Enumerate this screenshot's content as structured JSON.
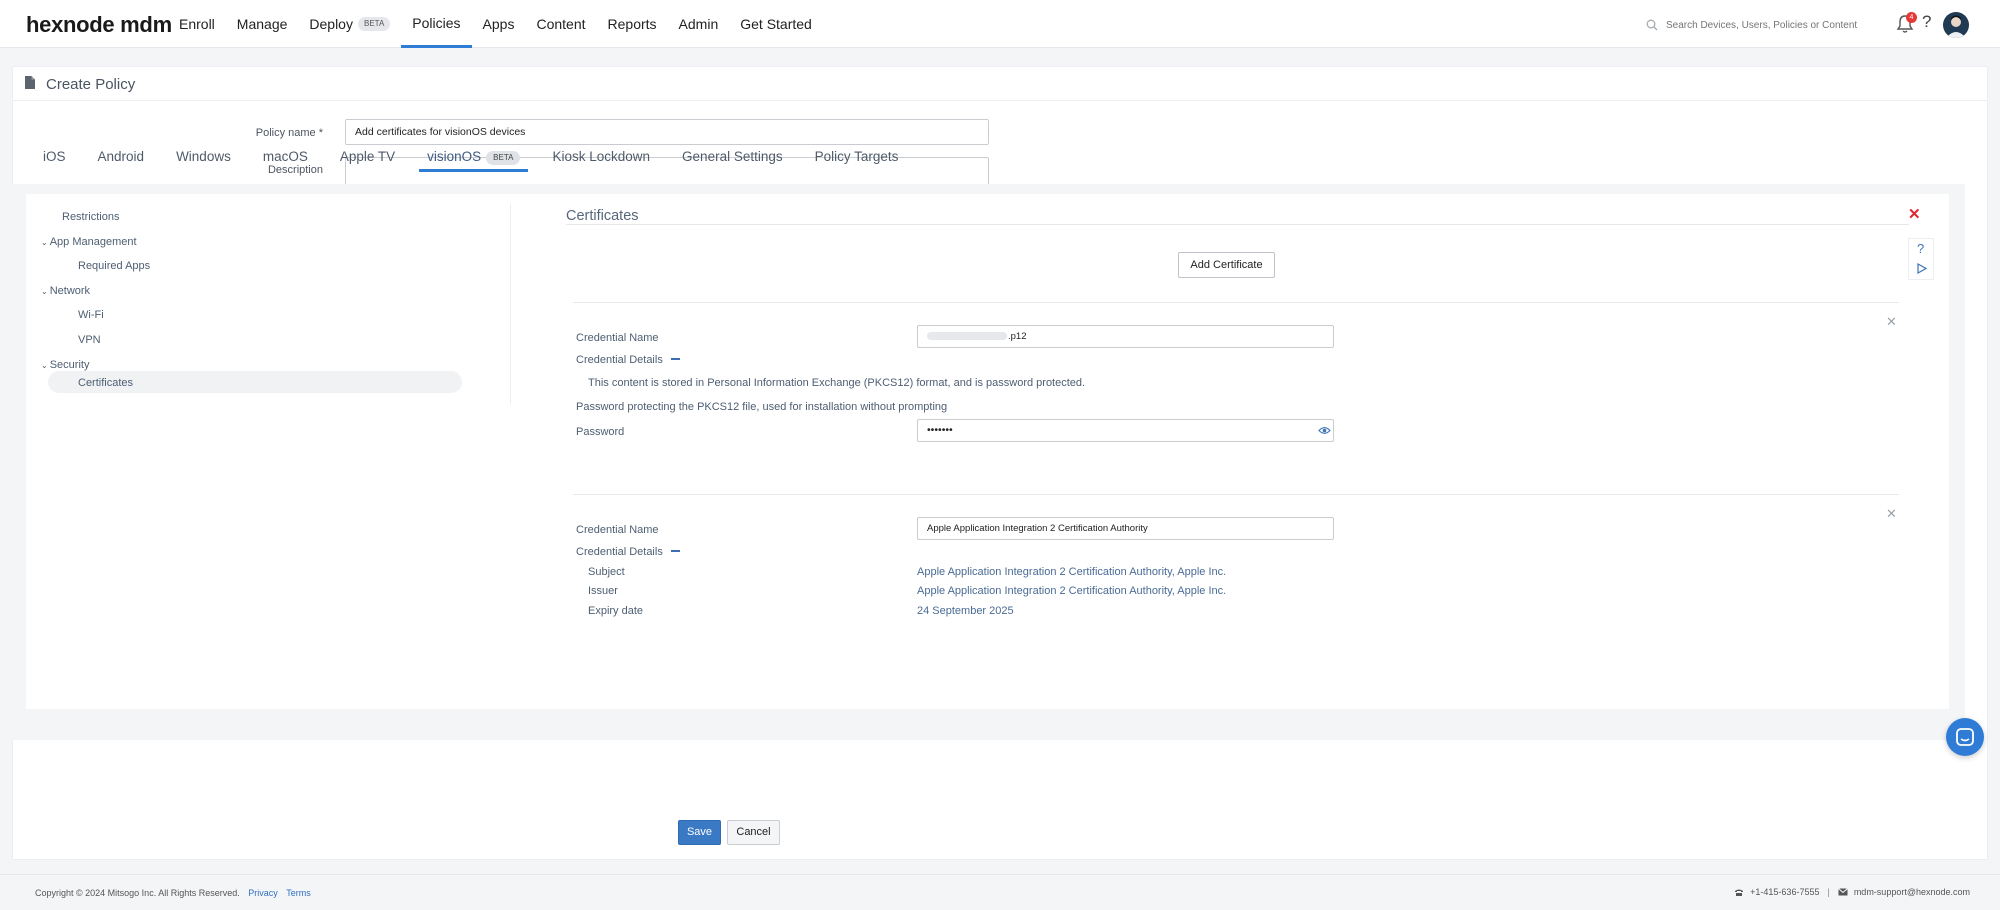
{
  "app": {
    "logo": "hexnode mdm"
  },
  "nav": {
    "items": [
      {
        "label": "Enroll"
      },
      {
        "label": "Manage"
      },
      {
        "label": "Deploy",
        "badge": "BETA"
      },
      {
        "label": "Policies",
        "active": true
      },
      {
        "label": "Apps"
      },
      {
        "label": "Content"
      },
      {
        "label": "Reports"
      },
      {
        "label": "Admin"
      },
      {
        "label": "Get Started"
      }
    ],
    "search_placeholder": "Search Devices, Users, Policies or Content",
    "notification_count": "4",
    "help": "?"
  },
  "page": {
    "title": "Create Policy"
  },
  "form": {
    "policy_name_label": "Policy name *",
    "policy_name_value": "Add certificates for visionOS devices",
    "description_label": "Description",
    "description_value": ""
  },
  "tabs": [
    {
      "label": "iOS"
    },
    {
      "label": "Android"
    },
    {
      "label": "Windows"
    },
    {
      "label": "macOS"
    },
    {
      "label": "Apple TV"
    },
    {
      "label": "visionOS",
      "badge": "BETA",
      "active": true
    },
    {
      "label": "Kiosk Lockdown"
    },
    {
      "label": "General Settings"
    },
    {
      "label": "Policy Targets"
    }
  ],
  "sidebar": {
    "restrictions": "Restrictions",
    "app_management": "App Management",
    "required_apps": "Required Apps",
    "network": "Network",
    "wifi": "Wi-Fi",
    "vpn": "VPN",
    "security": "Security",
    "certificates": "Certificates"
  },
  "certificates": {
    "title": "Certificates",
    "add_button": "Add Certificate",
    "cert1": {
      "credential_name_label": "Credential Name",
      "credential_name_suffix": ".p12",
      "credential_details_label": "Credential Details",
      "pkcs_note": "This content is stored in Personal Information Exchange (PKCS12) format, and is password protected.",
      "password_note": "Password protecting the PKCS12 file, used for installation without prompting",
      "password_label": "Password",
      "password_value": "•••••••"
    },
    "cert2": {
      "credential_name_label": "Credential Name",
      "credential_name_value": "Apple Application Integration 2 Certification Authority",
      "credential_details_label": "Credential Details",
      "subject_label": "Subject",
      "subject_value": "Apple Application Integration 2 Certification Authority, Apple Inc.",
      "issuer_label": "Issuer",
      "issuer_value": "Apple Application Integration 2 Certification Authority, Apple Inc.",
      "expiry_label": "Expiry date",
      "expiry_value": "24 September 2025"
    }
  },
  "actions": {
    "save": "Save",
    "cancel": "Cancel"
  },
  "footer": {
    "copyright": "Copyright © 2024 Mitsogo Inc. All Rights Reserved.",
    "privacy": "Privacy",
    "terms": "Terms",
    "phone": "+1-415-636-7555",
    "email": "mdm-support@hexnode.com"
  },
  "colors": {
    "accent": "#2e7cd6",
    "close_red": "#e0282e",
    "save_blue": "#3a79c4"
  }
}
